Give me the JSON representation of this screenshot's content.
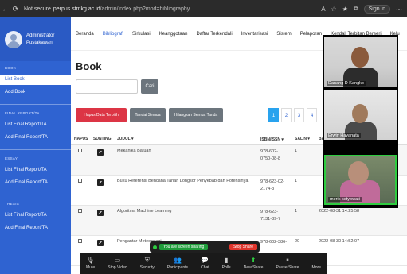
{
  "browser": {
    "security": "Not secure",
    "url_host": "perpus.stmkg.ac.id",
    "url_path": "/admin/index.php?mod=bibliography",
    "signin": "Sign in"
  },
  "sidebar": {
    "user_name": "Administrator",
    "user_role": "Pustakawan",
    "sections": [
      {
        "label": "BOOK",
        "items": [
          "List Book",
          "Add Book"
        ]
      },
      {
        "label": "FINAL REPORT/TA",
        "items": [
          "List Final Report/TA",
          "Add Final Report/TA"
        ]
      },
      {
        "label": "ESSAY",
        "items": [
          "List Final Report/TA",
          "Add Final Report/TA"
        ]
      },
      {
        "label": "THESIS",
        "items": [
          "List Final Report/TA",
          "Add Final Report/TA"
        ]
      }
    ]
  },
  "topnav": [
    "Beranda",
    "Bibliografi",
    "Sirkulasi",
    "Keanggotaan",
    "Daftar Terkendali",
    "Inventarisasi",
    "Sistem",
    "Pelaporan",
    "Kendali Terbitan Berseri",
    "Kelu"
  ],
  "content": {
    "title": "Book",
    "search_placeholder": "",
    "search_button": "Cari",
    "btn_delete": "Hapus Data Terpilih",
    "btn_select_all": "Tandai Semua",
    "btn_clear": "Hilangkan Semua Tanda",
    "pages": [
      "1",
      "2",
      "3",
      "4"
    ],
    "current_page": "1",
    "columns": {
      "hapus": "HAPUS",
      "sunting": "SUNTING",
      "judul": "JUDUL ▾",
      "isbn": "ISBN/ISSN ▾",
      "salin": "SALIN ▾",
      "extra": "BA"
    },
    "rows": [
      {
        "judul": "Mekanika Batuan",
        "isbn": "978-602-0750-08-8",
        "salin": "1",
        "date": ""
      },
      {
        "judul": "Buku Referensi Bencana Tanah Longsor Penyebab dan Potensinya",
        "isbn": "978-623-02-2174-3",
        "salin": "1",
        "date": ""
      },
      {
        "judul": "Algoritma Machine Learning",
        "isbn": "978-623-7131-39-7",
        "salin": "1",
        "date": "2022-08-31 14:25:58"
      },
      {
        "judul": "Pengantar Meteorologi",
        "isbn": "978-602-386-",
        "salin": "20",
        "date": "2022-08-30 14:52:07"
      }
    ]
  },
  "gallery": [
    {
      "name": "Danang D Kangko"
    },
    {
      "name": "Erwin Hayanata"
    },
    {
      "name": "merik setyowati"
    }
  ],
  "zoom": {
    "sharing_msg": "You are screen sharing",
    "stop_share": "Stop Share",
    "buttons": [
      "Mute",
      "Stop Video",
      "Security",
      "Participants",
      "Chat",
      "Polls",
      "New Share",
      "Pause Share",
      "More"
    ]
  }
}
